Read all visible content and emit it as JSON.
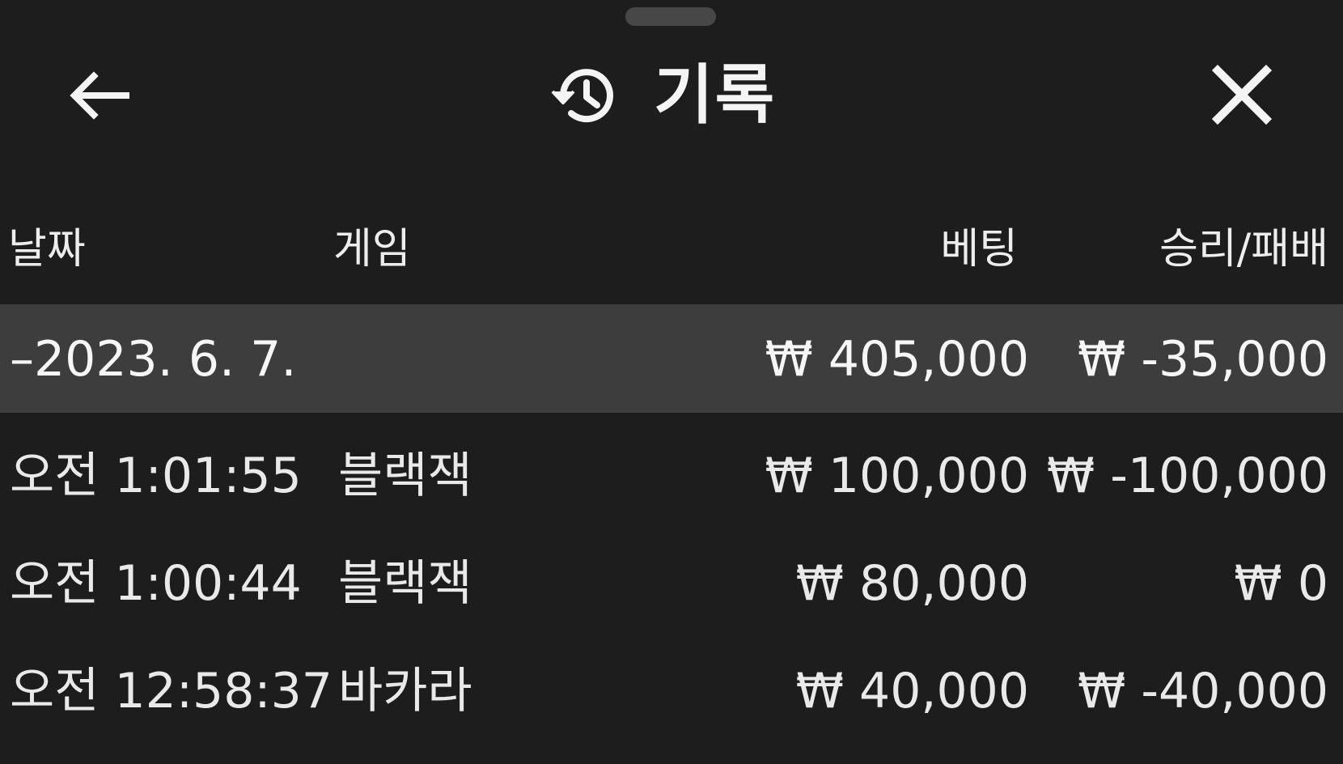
{
  "header": {
    "title": "기록",
    "back_icon": "arrow-left-icon",
    "history_icon": "history-icon",
    "close_icon": "close-icon"
  },
  "columns": {
    "date": "날짜",
    "game": "게임",
    "bet": "베팅",
    "result": "승리/패배"
  },
  "summary": {
    "date": "–2023. 6. 7.",
    "bet": "₩ 405,000",
    "result": "₩ -35,000"
  },
  "rows": [
    {
      "time": "오전 1:01:55",
      "game": "블랙잭",
      "bet": "₩ 100,000",
      "result": "₩ -100,000"
    },
    {
      "time": "오전 1:00:44",
      "game": "블랙잭",
      "bet": "₩ 80,000",
      "result": "₩ 0"
    },
    {
      "time": "오전 12:58:37",
      "game": "바카라",
      "bet": "₩ 40,000",
      "result": "₩ -40,000"
    }
  ],
  "colors": {
    "background": "#1d1d1d",
    "summary_bar": "#3d3d3d",
    "text": "#f2f2f2"
  }
}
